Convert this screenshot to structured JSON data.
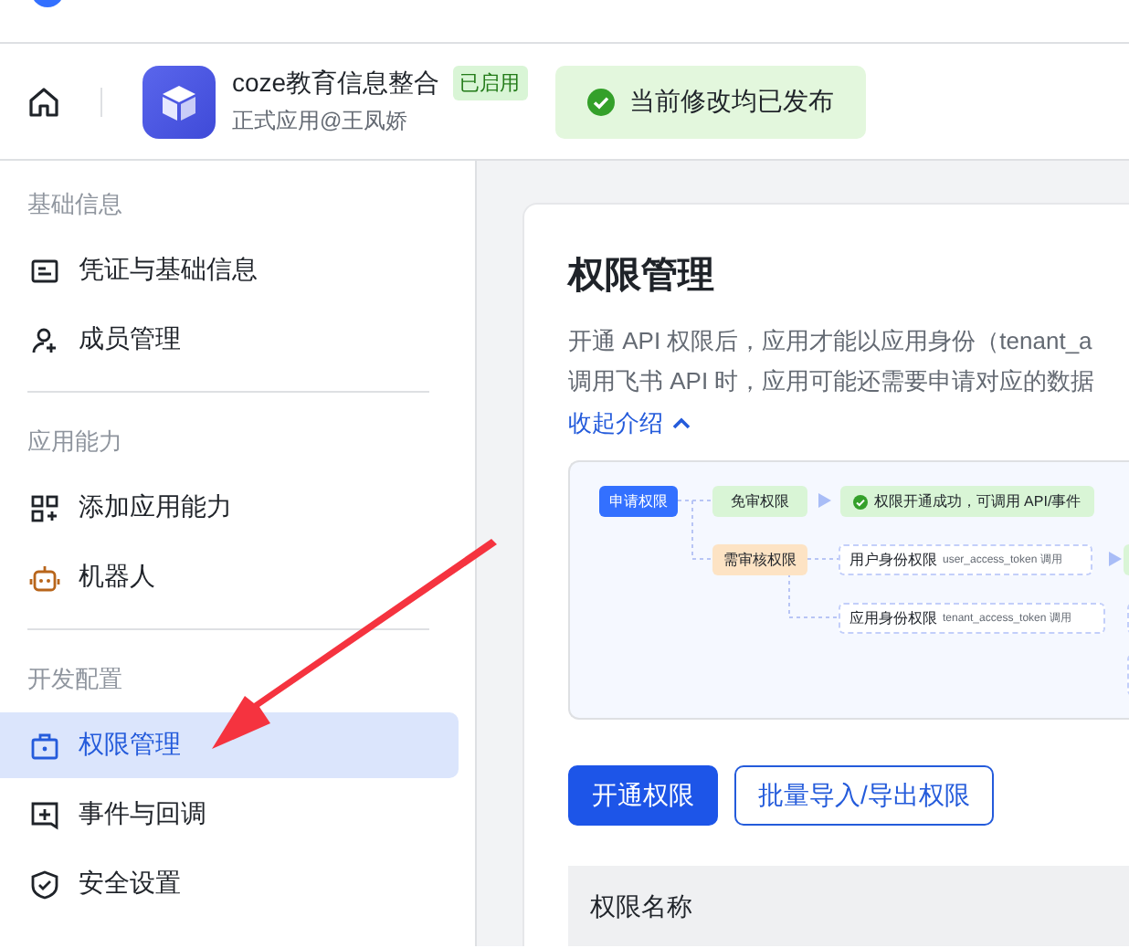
{
  "header": {
    "app": {
      "name": "coze教育信息整合",
      "status": "已启用",
      "subtitle": "正式应用@王凤娇"
    },
    "notice": "当前修改均已发布"
  },
  "sidebar": {
    "sections": [
      {
        "title": "基础信息",
        "items": [
          {
            "label": "凭证与基础信息",
            "selected": false
          },
          {
            "label": "成员管理",
            "selected": false
          }
        ]
      },
      {
        "title": "应用能力",
        "items": [
          {
            "label": "添加应用能力",
            "selected": false
          },
          {
            "label": "机器人",
            "selected": false
          }
        ]
      },
      {
        "title": "开发配置",
        "items": [
          {
            "label": "权限管理",
            "selected": true
          },
          {
            "label": "事件与回调",
            "selected": false
          },
          {
            "label": "安全设置",
            "selected": false
          }
        ]
      }
    ]
  },
  "content": {
    "title": "权限管理",
    "description": [
      "开通 API 权限后，应用才能以应用身份（tenant_a",
      "调用飞书 API 时，应用可能还需要申请对应的数据"
    ],
    "toggle": "收起介绍",
    "diagram": {
      "nodes": [
        {
          "kind": "request",
          "label": "申请权限"
        },
        {
          "kind": "free",
          "label": "免审权限"
        },
        {
          "kind": "success",
          "label": "权限开通成功，可调用 API/事件"
        },
        {
          "kind": "review",
          "label": "需审核权限"
        },
        {
          "kind": "scope",
          "label": "用户身份权限",
          "note": "user_access_token 调用"
        },
        {
          "kind": "scope",
          "label": "应用身份权限",
          "note": "tenant_access_token 调用"
        }
      ]
    },
    "buttons": [
      {
        "kind": "primary",
        "label": "开通权限"
      },
      {
        "kind": "secondary",
        "label": "批量导入/导出权限"
      }
    ],
    "table": {
      "columns": [
        "权限名称"
      ]
    }
  }
}
